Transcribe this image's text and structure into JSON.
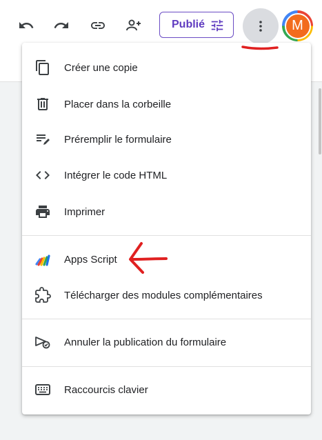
{
  "toolbar": {
    "undo_icon": "undo-icon",
    "redo_icon": "redo-icon",
    "link_icon": "link-icon",
    "add_collaborator_icon": "person-add-icon",
    "publish_label": "Publié",
    "more_icon": "more-vert-icon",
    "avatar_letter": "M"
  },
  "menu": {
    "items": [
      {
        "label": "Créer une copie",
        "icon": "copy-icon"
      },
      {
        "label": "Placer dans la corbeille",
        "icon": "trash-icon"
      },
      {
        "label": "Préremplir le formulaire",
        "icon": "prefill-icon"
      },
      {
        "label": "Intégrer le code HTML",
        "icon": "code-icon"
      },
      {
        "label": "Imprimer",
        "icon": "print-icon"
      },
      {
        "label": "Apps Script",
        "icon": "apps-script-icon"
      },
      {
        "label": "Télécharger des modules complémentaires",
        "icon": "puzzle-icon"
      },
      {
        "label": "Annuler la publication du formulaire",
        "icon": "unpublish-icon"
      },
      {
        "label": "Raccourcis clavier",
        "icon": "keyboard-icon"
      }
    ]
  },
  "colors": {
    "accent": "#5f3bc0",
    "annotation": "#e02020",
    "avatar_bg": "#f26b1d"
  }
}
